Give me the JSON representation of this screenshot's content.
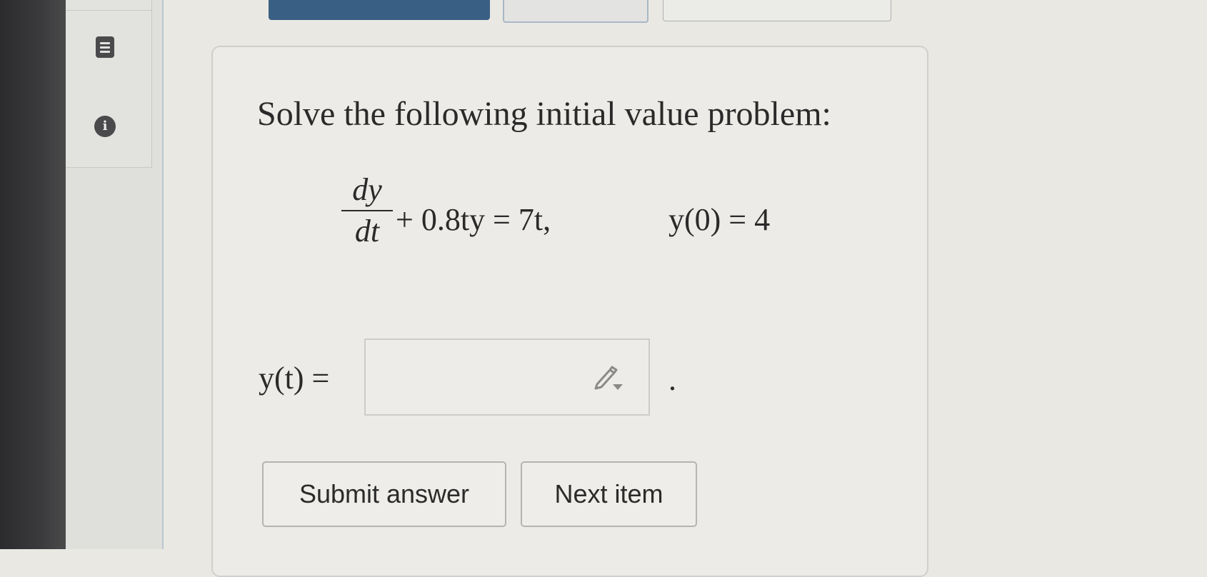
{
  "header": {
    "submit_label": "",
    "help_label": "",
    "practice_label": ""
  },
  "sidebar": {
    "icons": [
      "menu-icon",
      "info-icon"
    ],
    "info_glyph": "i"
  },
  "question": {
    "prompt": "Solve the following initial value problem:",
    "derivative_numerator": "dy",
    "derivative_denominator": "dt",
    "equation_rest": "+ 0.8ty = 7t,",
    "initial_condition": "y(0) = 4"
  },
  "answer": {
    "label": "y(t) =",
    "value": "",
    "trailing": ".",
    "editor_icon": "pencil-dropdown-icon"
  },
  "buttons": {
    "submit": "Submit answer",
    "next": "Next item"
  },
  "colors": {
    "primary_button": "#3a5f84",
    "page_background": "#e9e8e3",
    "text": "#2a2a2a"
  }
}
